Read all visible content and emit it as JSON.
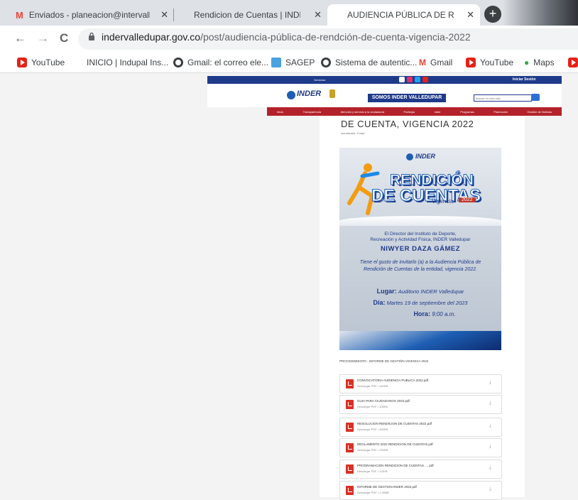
{
  "browser": {
    "tabs": [
      {
        "label": "Enviados - planeacion@intervall",
        "close": "✕"
      },
      {
        "label": "Rendicion de Cuentas | INDER VA",
        "close": "✕"
      },
      {
        "label": "AUDIENCIA PÚBLICA DE RENDICI",
        "close": "✕"
      }
    ],
    "new_tab": "+",
    "url_host": "indervalledupar.gov.co",
    "url_path": "/post/audiencia-pública-de-rendción-de-cuenta-vigencia-2022",
    "bookmarks": [
      "YouTube",
      "INICIO | Indupal Ins...",
      "Gmail: el correo ele...",
      "SAGEP",
      "Sistema de autentic...",
      "Gmail",
      "YouTube",
      "Maps"
    ],
    "colors": {
      "tabstrip": "#dee1e6",
      "youtube_red": "#e62117"
    }
  },
  "site": {
    "top_bar_text": "Iniciar Sesión",
    "top_bar_small": "Servicios",
    "logo": "INDER",
    "banner": "SOMOS INDER VALLEDUPAR",
    "search_placeholder": "Buscar en este sitio",
    "menu": [
      "Inicio",
      "Transparencia",
      "Atención y servicio a la ciudadanía",
      "Participa",
      "Inder",
      "Programas",
      "Planeación",
      "Gestión de Noticias"
    ],
    "colors": {
      "blue": "#1e3a8a",
      "red": "#b3222a"
    }
  },
  "post": {
    "title": "DE CUENTA, VIGENCIA 2022",
    "meta": "actualizado: 5 sept",
    "poster": {
      "logo": "INDER",
      "title_line1": "RENDICIÓN",
      "title_line2": "DE CUENTAS",
      "vigencia": "Vigencia",
      "year": "2022",
      "inviter_1": "El Director del Instituto de Deporte,",
      "inviter_2": "Recreación y Actividad Física, INDER Valledupar",
      "director": "NIWYER DAZA GÁMEZ",
      "invite_1": "Tiene el gusto de invitarlo (a) a la Audiencia Pública de",
      "invite_2": "Rendición de Cuentas de la entidad, vigencia 2022.",
      "place_label": "Lugar:",
      "place": "Auditorio INDER Valledupar",
      "day_label": "Día:",
      "day": "Martes 19 de septiembre del 2023",
      "time_label": "Hora:",
      "time": "9:00 a.m."
    },
    "section_heading": "PROCEDIMIENTO - INFORME DE GESTIÓN VIGENCIA 2022",
    "files": [
      {
        "name": "CONVOCATORIA AUDIENCIA PUBLICA 2022.pdf",
        "size": "Descargar PDF • 182KB"
      },
      {
        "name": "GUIA PARA CIUDADANOS 2022.pdf",
        "size": "Descargar PDF • 308KB"
      },
      {
        "name": "RESOLUCION RENDICION DE CUENTAS 2022.pdf",
        "size": "Descargar PDF • 250KB"
      },
      {
        "name": "REGLAMENTO 2022 RENDICION DE CUENTAS.pdf",
        "size": "Descargar PDF • 230KB"
      },
      {
        "name": "PROGRAMACION RENDICION DE CUENTAS .... pdf",
        "size": "Descargar PDF • 111KB"
      },
      {
        "name": "INFORME DE GESTION INDER 2022.pdf",
        "size": "Descargar PDF • 1.30MB"
      }
    ]
  }
}
